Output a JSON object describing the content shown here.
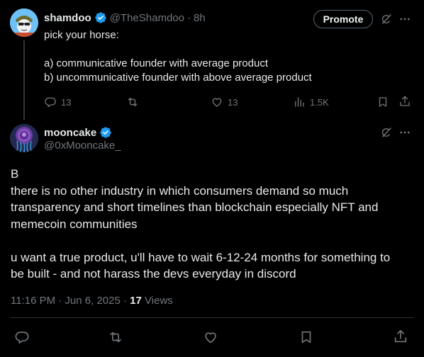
{
  "parent": {
    "author_name": "shamdoo",
    "author_handle": "@TheShamdoo",
    "separator": "·",
    "time": "8h",
    "promote_label": "Promote",
    "text_lines": [
      "pick your horse:",
      "",
      "a) communicative founder with average product",
      "b) uncommunicative founder with above average product"
    ],
    "actions": {
      "replies": "13",
      "reposts": "",
      "likes": "13",
      "views": "1.5K"
    }
  },
  "reply": {
    "author_name": "mooncake",
    "author_handle": "@0xMooncake_",
    "text_paragraphs": [
      [
        "B",
        "there is no other industry in which consumers demand so much",
        "transparency and short timelines than blockchain especially NFT and",
        "memecoin communities"
      ],
      [
        "u want a true product, u'll have to wait 6-12-24 months for something to",
        "be built - and not harass the devs everyday in discord"
      ]
    ],
    "timestamp": "11:16 PM · Jun 6, 2025",
    "meta_separator": " · ",
    "views_count": "17",
    "views_label": "Views"
  },
  "colors": {
    "background": "#000000",
    "text": "#e7e9ea",
    "muted": "#71767b",
    "verified": "#1d9bf0",
    "divider": "#2f3336"
  },
  "icons": {
    "reply": "reply-icon",
    "repost": "repost-icon",
    "like": "heart-icon",
    "views": "views-icon",
    "bookmark": "bookmark-icon",
    "share": "share-icon",
    "grok": "grok-icon",
    "more": "more-icon",
    "verified": "verified-badge-icon"
  }
}
